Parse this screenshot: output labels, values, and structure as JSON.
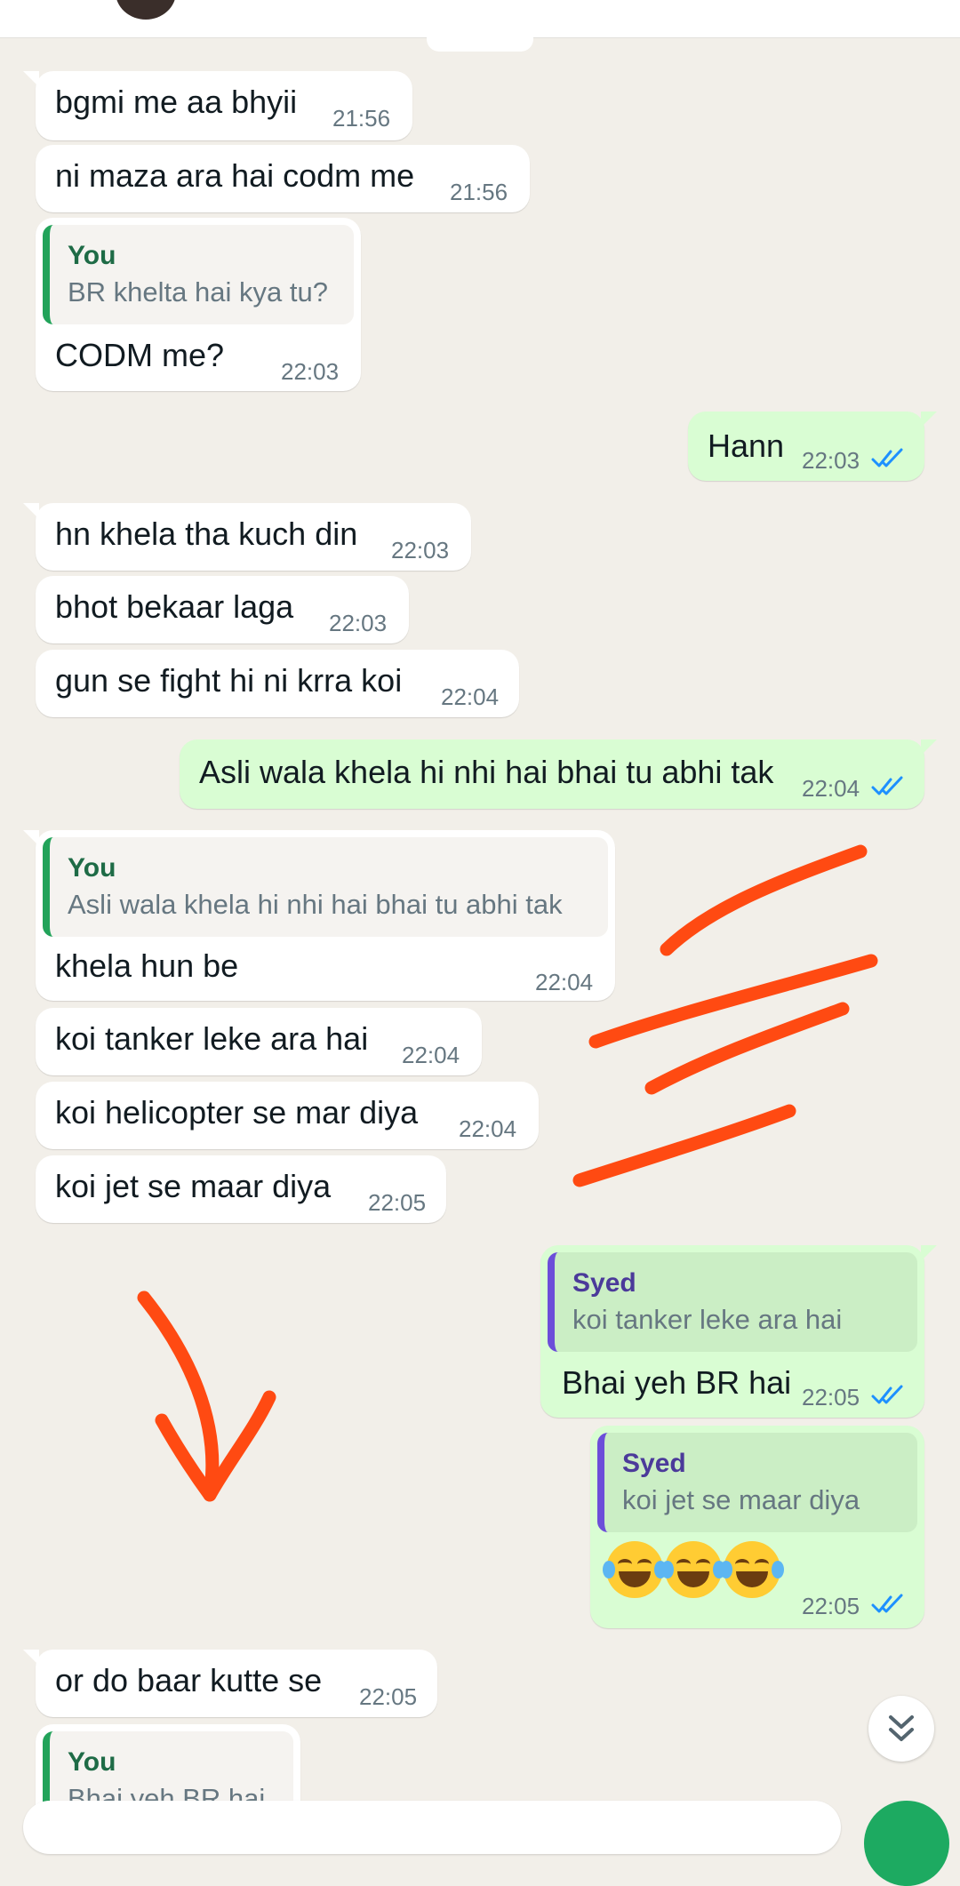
{
  "colors": {
    "background": "#f2efe9",
    "incoming_bubble": "#ffffff",
    "outgoing_bubble": "#d9fdd3",
    "read_ticks": "#1e90ff",
    "annotation": "#ff4a12",
    "quote_self_bar": "#22a35a",
    "quote_contact_bar": "#6c4ed9"
  },
  "messages": [
    {
      "text": "bgmi me aa bhyii",
      "time": "21:56"
    },
    {
      "text": "ni maza ara hai codm me",
      "time": "21:56"
    },
    {
      "quote_author": "You",
      "quote_text": "BR khelta hai kya tu?",
      "text": "CODM me?",
      "time": "22:03"
    },
    {
      "text": "Hann",
      "time": "22:03",
      "status": "read"
    },
    {
      "text": "hn khela tha kuch din",
      "time": "22:03"
    },
    {
      "text": "bhot bekaar laga",
      "time": "22:03"
    },
    {
      "text": "gun se fight hi ni krra koi",
      "time": "22:04"
    },
    {
      "text": "Asli wala khela hi nhi hai bhai tu abhi tak",
      "time": "22:04",
      "status": "read"
    },
    {
      "quote_author": "You",
      "quote_text": "Asli wala khela hi nhi hai bhai tu abhi tak",
      "text": "khela hun be",
      "time": "22:04"
    },
    {
      "text": "koi tanker leke ara hai",
      "time": "22:04"
    },
    {
      "text": "koi helicopter se mar diya",
      "time": "22:04"
    },
    {
      "text": "koi jet se maar diya",
      "time": "22:05"
    },
    {
      "quote_author": "Syed",
      "quote_text": "koi tanker leke ara hai",
      "text": "Bhai yeh BR hai",
      "time": "22:05",
      "status": "read"
    },
    {
      "quote_author": "Syed",
      "quote_text": "koi jet se maar diya",
      "emojis": [
        "face-with-tears-of-joy-icon",
        "face-with-tears-of-joy-icon",
        "face-with-tears-of-joy-icon"
      ],
      "time": "22:05",
      "status": "read"
    },
    {
      "text": "or do baar kutte se",
      "time": "22:05"
    },
    {
      "quote_author": "You",
      "quote_text": "Bhai yeh BR hai"
    }
  ],
  "icons": {
    "scroll_down": "double-chevron-down-icon",
    "read_status": "double-check-icon",
    "mic": "mic-icon"
  }
}
